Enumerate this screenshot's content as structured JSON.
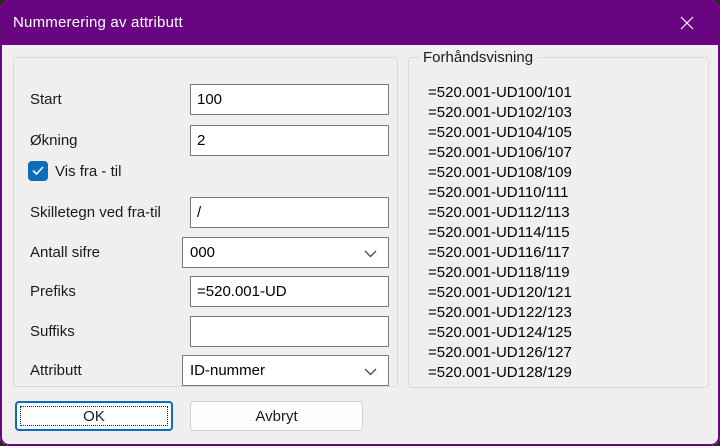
{
  "window": {
    "title": "Nummerering av attributt"
  },
  "colors": {
    "titlebar_purple": "#690580",
    "accent_blue": "#0f6cbd",
    "dialog_bg": "#efefef"
  },
  "form": {
    "start": {
      "label": "Start",
      "value": "100"
    },
    "okning": {
      "label": "Økning",
      "value": "2"
    },
    "vis_fra_til": {
      "label": "Vis fra - til",
      "checked": true
    },
    "skilletegn": {
      "label": "Skilletegn ved fra-til",
      "value": "/"
    },
    "antall_sifre": {
      "label": "Antall sifre",
      "value": "000"
    },
    "prefiks": {
      "label": "Prefiks",
      "value": "=520.001-UD"
    },
    "suffiks": {
      "label": "Suffiks",
      "value": ""
    },
    "attributt": {
      "label": "Attributt",
      "value": "ID-nummer"
    },
    "ok_label": "OK",
    "cancel_label": "Avbryt"
  },
  "preview": {
    "group_label": "Forhåndsvisning",
    "items": [
      "=520.001-UD100/101",
      "=520.001-UD102/103",
      "=520.001-UD104/105",
      "=520.001-UD106/107",
      "=520.001-UD108/109",
      "=520.001-UD110/111",
      "=520.001-UD112/113",
      "=520.001-UD114/115",
      "=520.001-UD116/117",
      "=520.001-UD118/119",
      "=520.001-UD120/121",
      "=520.001-UD122/123",
      "=520.001-UD124/125",
      "=520.001-UD126/127",
      "=520.001-UD128/129"
    ]
  }
}
